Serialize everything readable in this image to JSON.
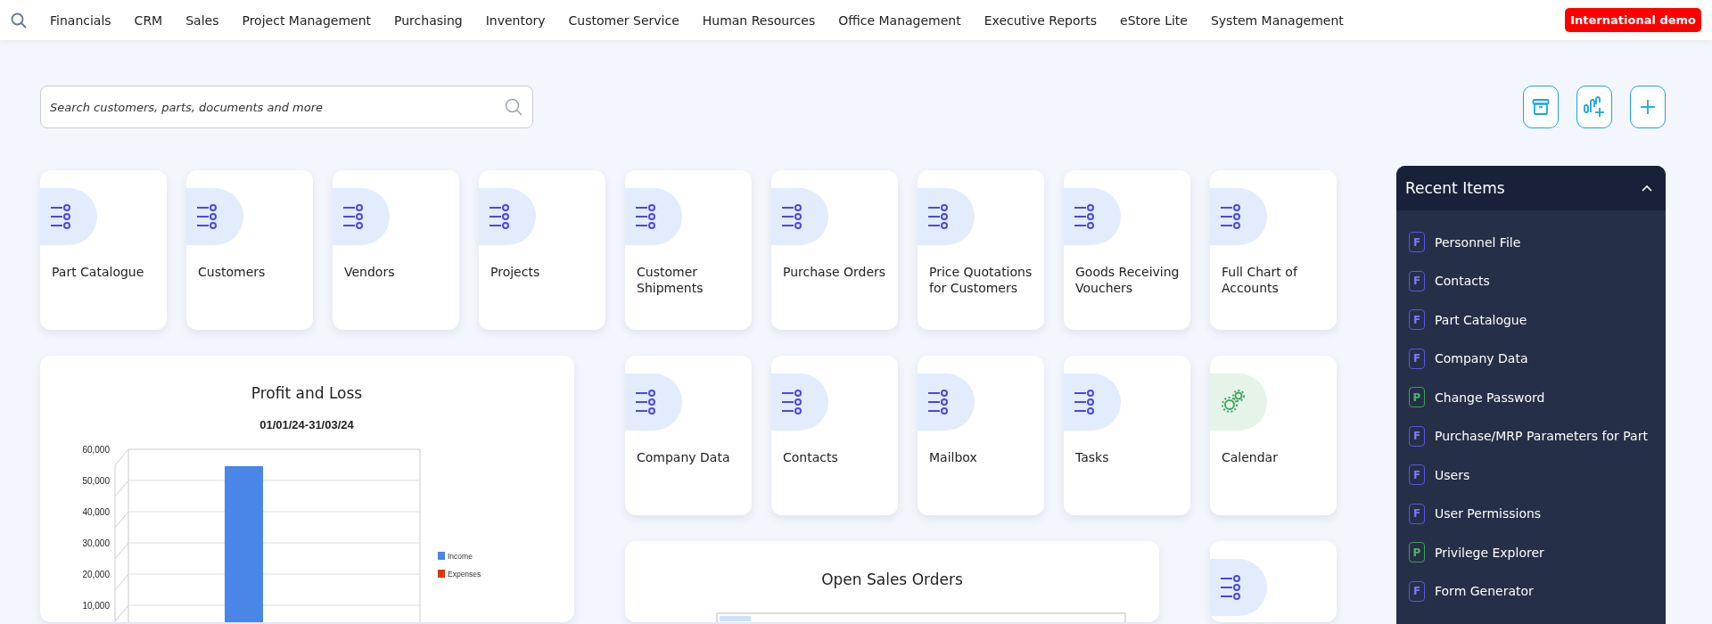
{
  "nav": {
    "items": [
      "Financials",
      "CRM",
      "Sales",
      "Project Management",
      "Purchasing",
      "Inventory",
      "Customer Service",
      "Human Resources",
      "Office Management",
      "Executive Reports",
      "eStore Lite",
      "System Management"
    ],
    "badge": "International demo"
  },
  "search": {
    "placeholder": "Search customers, parts, documents and more"
  },
  "tiles": [
    {
      "label": "Part Catalogue",
      "kind": "list"
    },
    {
      "label": "Customers",
      "kind": "list"
    },
    {
      "label": "Vendors",
      "kind": "list"
    },
    {
      "label": "Projects",
      "kind": "list"
    },
    {
      "label": "Customer Shipments",
      "kind": "list"
    },
    {
      "label": "Purchase Orders",
      "kind": "list"
    },
    {
      "label": "Price Quotations for Customers",
      "kind": "list"
    },
    {
      "label": "Goods Receiving Vouchers",
      "kind": "list"
    },
    {
      "label": "Full Chart of Accounts",
      "kind": "list"
    },
    {
      "label": "Company Data",
      "kind": "list"
    },
    {
      "label": "Contacts",
      "kind": "list"
    },
    {
      "label": "Mailbox",
      "kind": "list"
    },
    {
      "label": "Tasks",
      "kind": "list"
    },
    {
      "label": "Calendar",
      "kind": "gears"
    },
    {
      "kind": "list"
    }
  ],
  "profit_card": {
    "chart_data": {
      "type": "bar",
      "title": "Profit and Loss",
      "subtitle": "01/01/24-31/03/24",
      "series": [
        {
          "name": "Income",
          "color": "#4a86e8",
          "values": [
            54600
          ]
        },
        {
          "name": "Expenses",
          "color": "#dc3912",
          "values": [
            null
          ]
        }
      ],
      "ylim": [
        0,
        60000
      ],
      "grid": true,
      "yticks": [
        {
          "value": 10000,
          "label": "10,000"
        },
        {
          "value": 20000,
          "label": "20,000"
        },
        {
          "value": 30000,
          "label": "30,000"
        },
        {
          "value": 40000,
          "label": "40,000"
        },
        {
          "value": 50000,
          "label": "50,000"
        },
        {
          "value": 60000,
          "label": "60,000"
        }
      ]
    }
  },
  "sales_card": {
    "title": "Open Sales Orders"
  },
  "recent": {
    "title": "Recent Items",
    "expanded": true,
    "items": [
      {
        "badge": "F",
        "kind": "form",
        "label": "Personnel File"
      },
      {
        "badge": "F",
        "kind": "form",
        "label": "Contacts"
      },
      {
        "badge": "F",
        "kind": "form",
        "label": "Part Catalogue"
      },
      {
        "badge": "F",
        "kind": "form",
        "label": "Company Data"
      },
      {
        "badge": "P",
        "kind": "program",
        "label": "Change Password"
      },
      {
        "badge": "F",
        "kind": "form",
        "label": "Purchase/MRP Parameters for Part"
      },
      {
        "badge": "F",
        "kind": "form",
        "label": "Users"
      },
      {
        "badge": "F",
        "kind": "form",
        "label": "User Permissions"
      },
      {
        "badge": "P",
        "kind": "program",
        "label": "Privilege Explorer"
      },
      {
        "badge": "F",
        "kind": "form",
        "label": "Form Generator"
      }
    ]
  }
}
